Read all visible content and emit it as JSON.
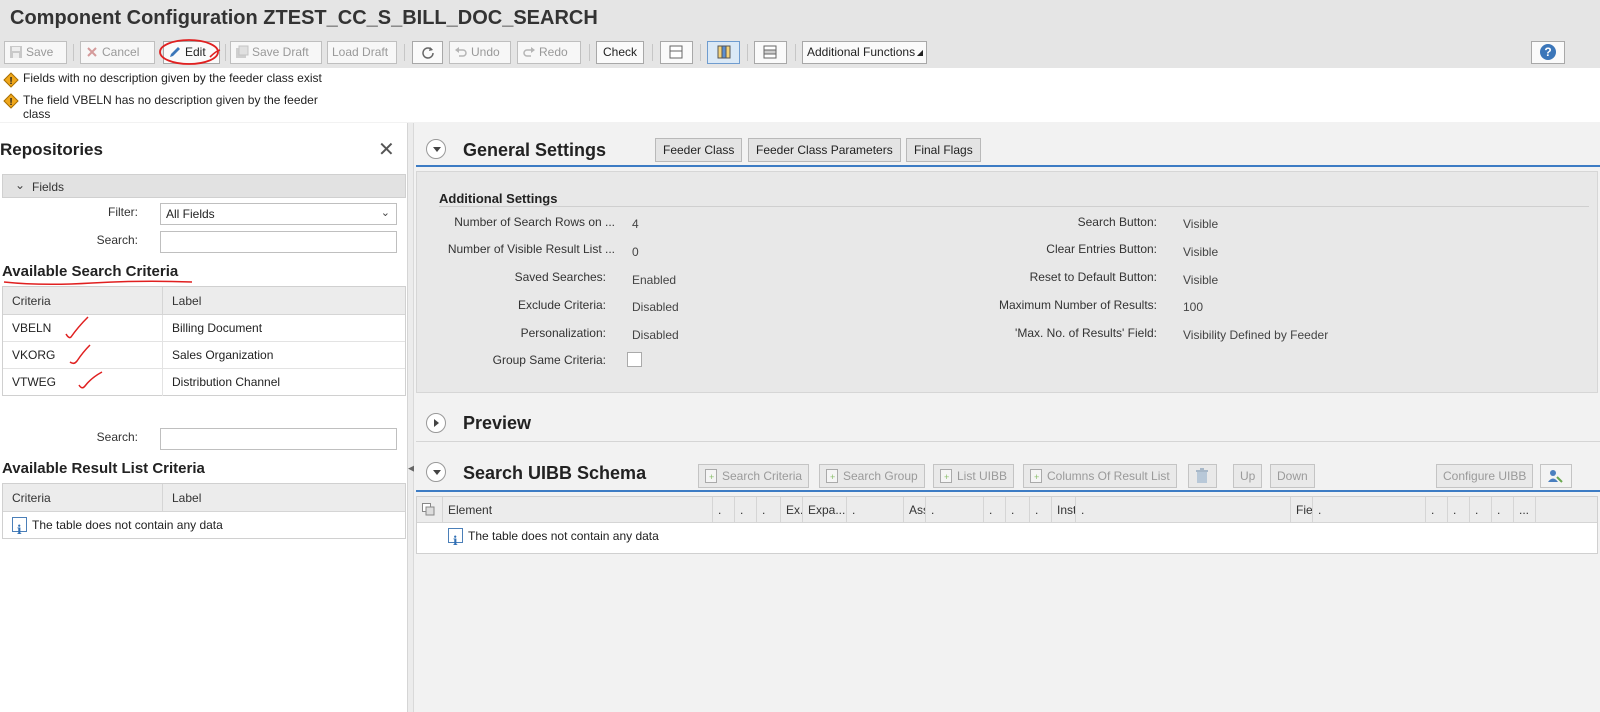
{
  "title": "Component Configuration ZTEST_CC_S_BILL_DOC_SEARCH",
  "toolbar": {
    "save": "Save",
    "cancel": "Cancel",
    "edit": "Edit",
    "save_draft": "Save Draft",
    "load_draft": "Load Draft",
    "undo": "Undo",
    "redo": "Redo",
    "check": "Check",
    "additional_functions": "Additional Functions",
    "help": "?"
  },
  "messages": [
    "Fields with no description given by the feeder class exist",
    "The field VBELN has no description given by the feeder class"
  ],
  "repositories": {
    "title": "Repositories",
    "group": "Fields",
    "filter_label": "Filter:",
    "filter_value": "All Fields",
    "search_label": "Search:",
    "search_value": "",
    "search_criteria_title": "Available Search Criteria",
    "columns": [
      "Criteria",
      "Label"
    ],
    "rows": [
      {
        "criteria": "VBELN",
        "label": "Billing Document"
      },
      {
        "criteria": "VKORG",
        "label": "Sales Organization"
      },
      {
        "criteria": "VTWEG",
        "label": "Distribution Channel"
      }
    ],
    "search2_label": "Search:",
    "result_list_title": "Available Result List Criteria",
    "result_columns": [
      "Criteria",
      "Label"
    ],
    "empty_text": "The table does not contain any data"
  },
  "general_settings": {
    "title": "General Settings",
    "buttons": [
      "Feeder Class",
      "Feeder Class Parameters",
      "Final Flags"
    ],
    "section_title": "Additional Settings",
    "left": [
      {
        "label": "Number of Search Rows on ...",
        "value": "4"
      },
      {
        "label": "Number of Visible Result List ...",
        "value": "0"
      },
      {
        "label": "Saved Searches:",
        "value": "Enabled"
      },
      {
        "label": "Exclude Criteria:",
        "value": "Disabled"
      },
      {
        "label": "Personalization:",
        "value": "Disabled"
      },
      {
        "label": "Group Same Criteria:",
        "value": ""
      }
    ],
    "right": [
      {
        "label": "Search Button:",
        "value": "Visible"
      },
      {
        "label": "Clear Entries Button:",
        "value": "Visible"
      },
      {
        "label": "Reset to Default Button:",
        "value": "Visible"
      },
      {
        "label": "Maximum Number of Results:",
        "value": "100"
      },
      {
        "label": "'Max. No. of Results' Field:",
        "value": "Visibility Defined by Feeder"
      }
    ]
  },
  "preview": {
    "title": "Preview"
  },
  "schema": {
    "title": "Search UIBB Schema",
    "buttons": {
      "search_criteria": "Search Criteria",
      "search_group": "Search Group",
      "list_uibb": "List UIBB",
      "columns_result": "Columns Of Result List",
      "up": "Up",
      "down": "Down",
      "configure_uibb": "Configure UIBB"
    },
    "columns": [
      "Element",
      ".",
      ".",
      ".",
      "Ex...",
      "Expa...",
      ".",
      "Assi...",
      ".",
      ".",
      ".",
      ".",
      "Instance ID",
      ".",
      "Field Name",
      ".",
      ".",
      ".",
      ".",
      ".",
      "..."
    ],
    "empty_text": "The table does not contain any data"
  }
}
